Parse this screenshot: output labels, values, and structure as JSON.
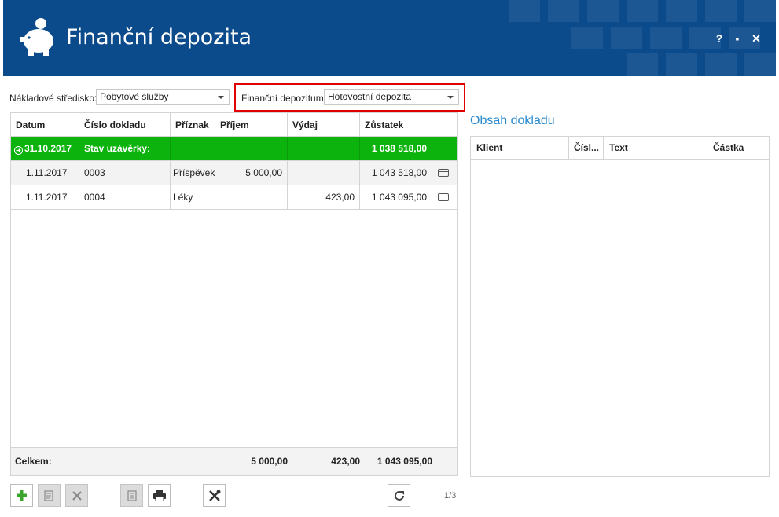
{
  "window": {
    "title": "Finanční depozita",
    "help": "?",
    "maximize": "▪",
    "close": "✕"
  },
  "filters": {
    "cost_center_label": "Nákladové středisko:",
    "cost_center_value": "Pobytové služby",
    "deposit_label": "Finanční depozitum:",
    "deposit_value": "Hotovostní depozita"
  },
  "table": {
    "columns": [
      "Datum",
      "Číslo dokladu",
      "Příznak",
      "Příjem",
      "Výdaj",
      "Zůstatek",
      ""
    ],
    "closing_row": {
      "date": "31.10.2017",
      "label": "Stav uzávěrky:",
      "balance": "1 038 518,00"
    },
    "rows": [
      {
        "date": "1.11.2017",
        "doc": "0003",
        "flag": "Příspěvek",
        "income": "5 000,00",
        "expense": "",
        "balance": "1 043 518,00"
      },
      {
        "date": "1.11.2017",
        "doc": "0004",
        "flag": "Léky",
        "income": "",
        "expense": "423,00",
        "balance": "1 043 095,00"
      }
    ],
    "footer": {
      "label": "Celkem:",
      "income": "5 000,00",
      "expense": "423,00",
      "balance": "1 043 095,00"
    }
  },
  "detail": {
    "title": "Obsah dokladu",
    "columns": [
      "Klient",
      "Čísl...",
      "Text",
      "Částka"
    ]
  },
  "toolbar": {
    "pager": "1/3",
    "icons": [
      "add-icon",
      "edit-icon",
      "delete-icon",
      "document-icon",
      "print-icon",
      "tools-icon",
      "refresh-icon"
    ]
  },
  "colors": {
    "header_bg": "#0b4a8b",
    "closing_row_bg": "#0cb30c",
    "highlight": "#e10000",
    "accent_title": "#2a8bd0"
  }
}
